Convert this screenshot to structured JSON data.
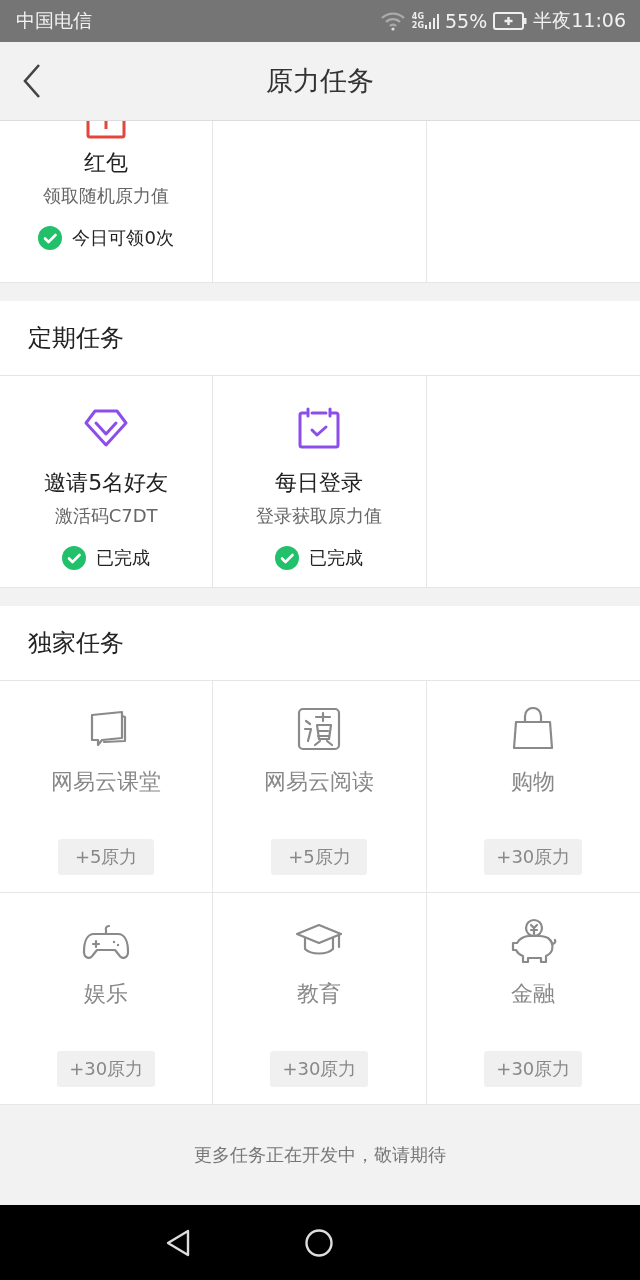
{
  "status_bar": {
    "carrier": "中国电信",
    "network": [
      "4G",
      "2G"
    ],
    "battery": "55%",
    "time": "半夜11:06"
  },
  "header": {
    "title": "原力任务"
  },
  "top_tasks": [
    {
      "name": "红包",
      "desc": "领取随机原力值",
      "status": "今日可领0次",
      "done": true
    }
  ],
  "sections": [
    {
      "title": "定期任务",
      "kind": "regular",
      "tasks": [
        {
          "name": "邀请5名好友",
          "desc": "激活码C7DT",
          "status": "已完成",
          "done": true
        },
        {
          "name": "每日登录",
          "desc": "登录获取原力值",
          "status": "已完成",
          "done": true
        }
      ]
    },
    {
      "title": "独家任务",
      "kind": "exclusive",
      "tasks": [
        {
          "name": "网易云课堂",
          "reward": "+5原力"
        },
        {
          "name": "网易云阅读",
          "reward": "+5原力"
        },
        {
          "name": "购物",
          "reward": "+30原力"
        },
        {
          "name": "娱乐",
          "reward": "+30原力"
        },
        {
          "name": "教育",
          "reward": "+30原力"
        },
        {
          "name": "金融",
          "reward": "+30原力"
        }
      ]
    }
  ],
  "footer": "更多任务正在开发中，敬请期待"
}
